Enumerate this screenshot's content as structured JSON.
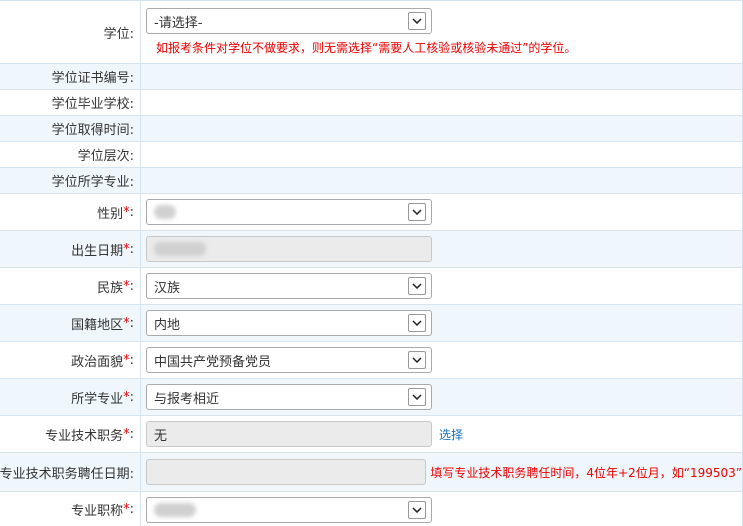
{
  "degree": {
    "label": "学位:",
    "select_value": "-请选择-",
    "hint": "如报考条件对学位不做要求，则无需选择“需要人工核验或核验未通过”的学位。"
  },
  "info_rows": [
    {
      "label": "学位证书编号:"
    },
    {
      "label": "学位毕业学校:"
    },
    {
      "label": "学位取得时间:"
    },
    {
      "label": "学位层次:"
    },
    {
      "label": "学位所学专业:"
    }
  ],
  "required_mark": "*",
  "gender": {
    "label": "性别",
    "colon": ":"
  },
  "birth_date": {
    "label": "出生日期",
    "colon": ":"
  },
  "ethnicity": {
    "label": "民族",
    "colon": ":",
    "value": "汉族"
  },
  "region": {
    "label": "国籍地区",
    "colon": ":",
    "value": "内地"
  },
  "political_status": {
    "label": "政治面貌",
    "colon": ":",
    "value": "中国共产党预备党员"
  },
  "major": {
    "label": "所学专业",
    "colon": ":",
    "value": "与报考相近"
  },
  "tech_title": {
    "label": "专业技术职务",
    "colon": ":",
    "value": "无",
    "link": "选择"
  },
  "tech_title_date": {
    "label": "专业技术职务聘任日期:",
    "value": "",
    "hint": "填写专业技术职务聘任时间，4位年+2位月，如“199503”"
  },
  "pro_title": {
    "label": "专业职称",
    "colon": ":"
  }
}
